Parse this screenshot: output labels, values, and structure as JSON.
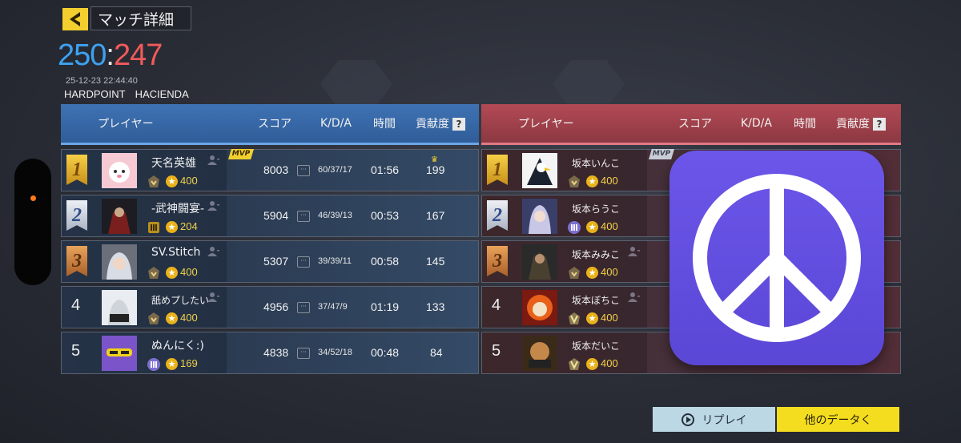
{
  "header": {
    "title": "マッチ詳細",
    "score_blue": "250",
    "score_sep": ":",
    "score_red": "247",
    "datetime": "25-12-23 22:44:40",
    "mode": "HARDPOINT",
    "map": "HACIENDA"
  },
  "columns": {
    "player": "プレイヤー",
    "score": "スコア",
    "kda": "K/D/A",
    "time": "時間",
    "contribution": "貢献度",
    "help": "?"
  },
  "blue_team": [
    {
      "rank": "1",
      "name": "天名英雄",
      "level": "400",
      "score": "8003",
      "kda": "60/37/17",
      "time": "01:56",
      "contribution": "199",
      "mvp": "MVP"
    },
    {
      "rank": "2",
      "name": "-武神闘宴-",
      "level": "204",
      "score": "5904",
      "kda": "46/39/13",
      "time": "00:53",
      "contribution": "167"
    },
    {
      "rank": "3",
      "name": "SV.Stitch",
      "level": "400",
      "score": "5307",
      "kda": "39/39/11",
      "time": "00:58",
      "contribution": "145"
    },
    {
      "rank": "4",
      "name": "舐めプしたい",
      "level": "400",
      "score": "4956",
      "kda": "37/47/9",
      "time": "01:19",
      "contribution": "133"
    },
    {
      "rank": "5",
      "name": "ぬんにく:)",
      "level": "169",
      "score": "4838",
      "kda": "34/52/18",
      "time": "00:48",
      "contribution": "84"
    }
  ],
  "red_team": [
    {
      "rank": "1",
      "name": "坂本いんこ",
      "level": "400",
      "mvp": "MVP"
    },
    {
      "rank": "2",
      "name": "坂本らうこ",
      "level": "400"
    },
    {
      "rank": "3",
      "name": "坂本みみこ",
      "level": "400"
    },
    {
      "rank": "4",
      "name": "坂本ぼちこ",
      "level": "400"
    },
    {
      "rank": "5",
      "name": "坂本だいこ",
      "level": "400"
    }
  ],
  "buttons": {
    "replay": "リプレイ",
    "other_data": "他のデータく"
  },
  "colors": {
    "blue_score": "#3da2f2",
    "red_score": "#f25a5a",
    "blue_header": "#3f72b3",
    "red_header": "#b34a55",
    "overlay": "#5a47d6",
    "accent_yellow": "#f4dd1e"
  },
  "icons": {
    "back": "back-arrow-icon",
    "help": "question-icon",
    "overlay": "peace-sign-icon"
  }
}
